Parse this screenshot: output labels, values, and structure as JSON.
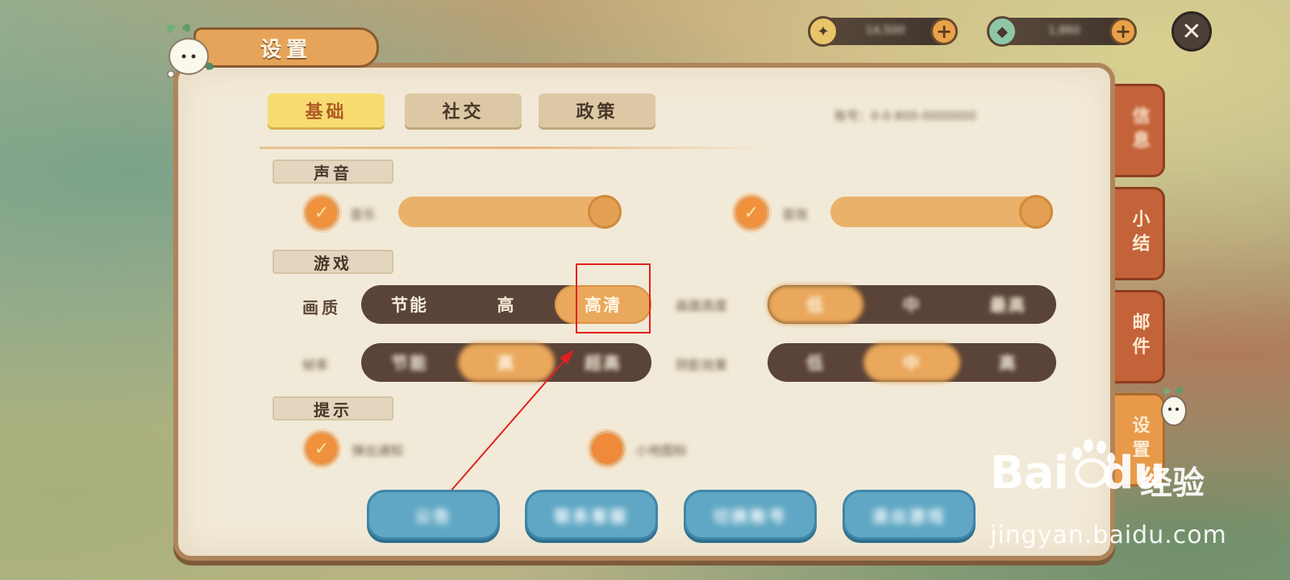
{
  "title": "设置",
  "currencies": [
    {
      "icon": "star-coin-icon",
      "value": "14,500"
    },
    {
      "icon": "gem-icon",
      "value": "1,860"
    }
  ],
  "tabs": [
    {
      "label": "基础",
      "active": true
    },
    {
      "label": "社交",
      "active": false
    },
    {
      "label": "政策",
      "active": false
    }
  ],
  "account_id": "账号：0-0-800-0000000",
  "sections": {
    "sound": "声音",
    "game": "游戏",
    "tips": "提示"
  },
  "sound": {
    "music_label": "音乐",
    "music_level": 1.0,
    "effects_label": "音效",
    "effects_level": 1.0
  },
  "graphics": {
    "label": "画质",
    "options": [
      "节能",
      "高",
      "高清"
    ],
    "selected": "高清"
  },
  "blur_rows": {
    "row1_right": {
      "label": "画面高度",
      "options": [
        "低",
        "中",
        "最高"
      ]
    },
    "row2_left": {
      "label": "帧率",
      "options": [
        "节能",
        "高",
        "超高"
      ]
    },
    "row2_right": {
      "label": "阴影效果",
      "options": [
        "低",
        "中",
        "高"
      ]
    }
  },
  "tips": {
    "item1": "弹出通知",
    "item2": "小地图标"
  },
  "buttons": [
    "公告",
    "联系客服",
    "切换账号",
    "退出游戏"
  ],
  "side_tabs": [
    {
      "label": "信息",
      "active": false
    },
    {
      "label": "小结",
      "active": false
    },
    {
      "label": "邮件",
      "active": false
    },
    {
      "label": "设置",
      "active": true
    }
  ],
  "watermark": {
    "brand": "Bai",
    "brand2": "du",
    "suffix": "经验",
    "url": "jingyan.baidu.com"
  },
  "colors": {
    "accent_orange": "#eaa85c",
    "highlight_red": "#e02020",
    "button_blue": "#5fa7c4",
    "panel_bg": "#f2ead8"
  }
}
